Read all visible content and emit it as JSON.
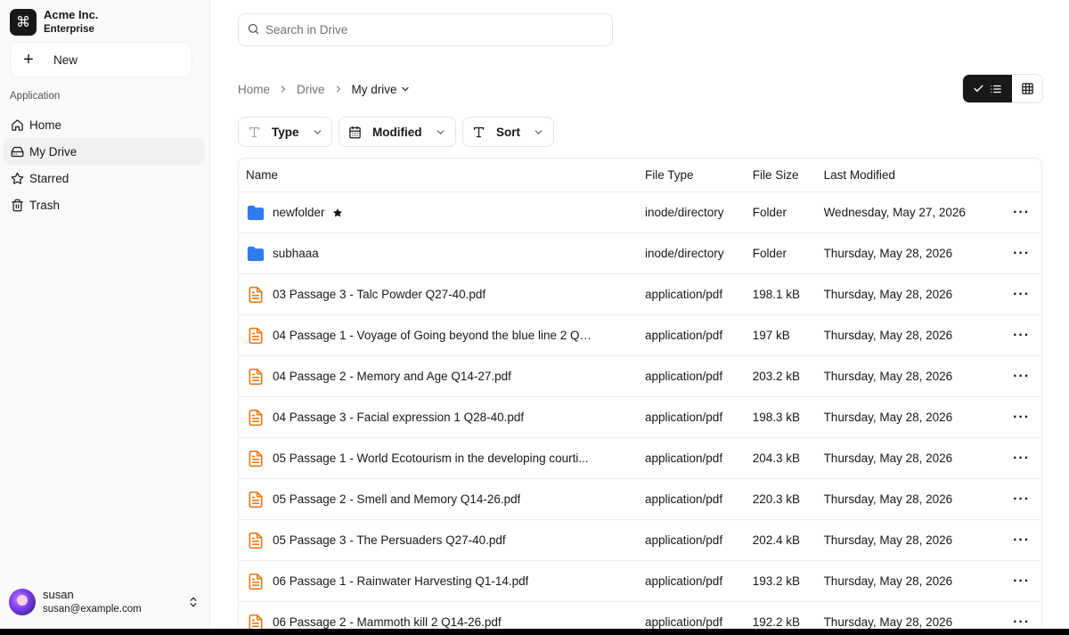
{
  "brand": {
    "name": "Acme Inc.",
    "plan": "Enterprise",
    "logo_glyph": "⌘"
  },
  "sidebar": {
    "new_label": "New",
    "section_label": "Application",
    "items": [
      {
        "label": "Home",
        "icon": "home-icon",
        "active": false
      },
      {
        "label": "My Drive",
        "icon": "drive-icon",
        "active": true
      },
      {
        "label": "Starred",
        "icon": "star-icon",
        "active": false
      },
      {
        "label": "Trash",
        "icon": "trash-icon",
        "active": false
      }
    ]
  },
  "user": {
    "name": "susan",
    "email": "susan@example.com"
  },
  "search": {
    "placeholder": "Search in Drive",
    "value": ""
  },
  "breadcrumb": {
    "home": "Home",
    "drive": "Drive",
    "current": "My drive"
  },
  "view": {
    "mode": "list"
  },
  "filters": {
    "type": "Type",
    "modified": "Modified",
    "sort": "Sort"
  },
  "table": {
    "headers": {
      "name": "Name",
      "type": "File Type",
      "size": "File Size",
      "modified": "Last Modified"
    },
    "rows": [
      {
        "name": "newfolder",
        "kind": "folder",
        "starred": true,
        "type": "inode/directory",
        "size": "Folder",
        "modified": "Wednesday, May 27, 2026"
      },
      {
        "name": "subhaaa",
        "kind": "folder",
        "starred": false,
        "type": "inode/directory",
        "size": "Folder",
        "modified": "Thursday, May 28, 2026"
      },
      {
        "name": "03 Passage 3 - Talc Powder Q27-40.pdf",
        "kind": "pdf",
        "starred": false,
        "type": "application/pdf",
        "size": "198.1 kB",
        "modified": "Thursday, May 28, 2026"
      },
      {
        "name": "04 Passage 1 - Voyage of Going beyond the blue line 2 Q1...",
        "kind": "pdf",
        "starred": false,
        "type": "application/pdf",
        "size": "197 kB",
        "modified": "Thursday, May 28, 2026"
      },
      {
        "name": "04 Passage 2 - Memory and Age Q14-27.pdf",
        "kind": "pdf",
        "starred": false,
        "type": "application/pdf",
        "size": "203.2 kB",
        "modified": "Thursday, May 28, 2026"
      },
      {
        "name": "04 Passage 3 - Facial expression 1 Q28-40.pdf",
        "kind": "pdf",
        "starred": false,
        "type": "application/pdf",
        "size": "198.3 kB",
        "modified": "Thursday, May 28, 2026"
      },
      {
        "name": "05 Passage 1 - World Ecotourism in the developing courti...",
        "kind": "pdf",
        "starred": false,
        "type": "application/pdf",
        "size": "204.3 kB",
        "modified": "Thursday, May 28, 2026"
      },
      {
        "name": "05 Passage 2 - Smell and Memory Q14-26.pdf",
        "kind": "pdf",
        "starred": false,
        "type": "application/pdf",
        "size": "220.3 kB",
        "modified": "Thursday, May 28, 2026"
      },
      {
        "name": "05 Passage 3 - The Persuaders Q27-40.pdf",
        "kind": "pdf",
        "starred": false,
        "type": "application/pdf",
        "size": "202.4 kB",
        "modified": "Thursday, May 28, 2026"
      },
      {
        "name": "06 Passage 1 - Rainwater Harvesting Q1-14.pdf",
        "kind": "pdf",
        "starred": false,
        "type": "application/pdf",
        "size": "193.2 kB",
        "modified": "Thursday, May 28, 2026"
      },
      {
        "name": "06 Passage 2 - Mammoth kill 2 Q14-26.pdf",
        "kind": "pdf",
        "starred": false,
        "type": "application/pdf",
        "size": "192.2 kB",
        "modified": "Thursday, May 28, 2026"
      }
    ]
  },
  "colors": {
    "folder": "#2f7bf0",
    "pdf": "#ea7b15",
    "accent": "#18181b",
    "border": "#e4e4e7",
    "muted": "#71717a"
  }
}
